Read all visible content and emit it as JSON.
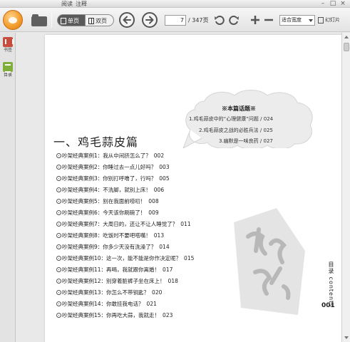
{
  "tabs": [
    "阅读",
    "注释"
  ],
  "window_controls": {
    "minimize": "–",
    "maximize": "□",
    "close": "×"
  },
  "toolbar": {
    "single_page": "单页",
    "double_page": "双页",
    "current_page": "7",
    "total_pages": "/ 347页",
    "zoom_mode": "适合宽度",
    "slideshow": "幻灯片",
    "icons": [
      "app-logo-icon",
      "open-folder-icon",
      "prev-page-icon",
      "next-page-icon",
      "rotate-left-icon",
      "rotate-right-icon",
      "zoom-in-icon",
      "zoom-out-icon",
      "slideshow-icon"
    ]
  },
  "sidebar": {
    "items": [
      {
        "label": "书签",
        "icon": "bookmark-icon"
      },
      {
        "label": "目录",
        "icon": "toc-icon"
      }
    ]
  },
  "page": {
    "bubble": {
      "title": "※本篇话题※",
      "items": [
        "1.鸡毛蒜皮中的“心理健康”问题 / 024",
        "2.鸡毛蒜皮之战的必胜兵法 / 025",
        "3.幽默是一味良药 / 027"
      ]
    },
    "chapter_title": "一、鸡毛蒜皮篇",
    "toc": [
      {
        "text": "吵架经典案例1：我从中间挤怎么了？",
        "page": "002"
      },
      {
        "text": "吵架经典案例2：你睡过去一点儿好吗？",
        "page": "003"
      },
      {
        "text": "吵架经典案例3：你别打呼噜了，行吗？",
        "page": "005"
      },
      {
        "text": "吵架经典案例4：不洗脚，就别上床！",
        "page": "006"
      },
      {
        "text": "吵架经典案例5：别在我面前唠叨！",
        "page": "008"
      },
      {
        "text": "吵架经典案例6：今天该你刷碗了！",
        "page": "009"
      },
      {
        "text": "吵架经典案例7：大周日的，还让不让人睡觉了？",
        "page": "011"
      },
      {
        "text": "吵架经典案例8：吃饭时不要吧嗒嘴！",
        "page": "013"
      },
      {
        "text": "吵架经典案例9：你多少天没有洗澡了？",
        "page": "014"
      },
      {
        "text": "吵架经典案例10：这一次，能不能是你作决定呢？",
        "page": "015"
      },
      {
        "text": "吵架经典案例11：再喝，我就跟你离婚！",
        "page": "017"
      },
      {
        "text": "吵架经典案例12：别穿着脏裤子坐在床上！",
        "page": "018"
      },
      {
        "text": "吵架经典案例13：你怎么不带钥匙？",
        "page": "020"
      },
      {
        "text": "吵架经典案例14：你敢挂我电话？",
        "page": "021"
      },
      {
        "text": "吵架经典案例15：你再吃大蒜，我就走！",
        "page": "023"
      }
    ],
    "side_label": "目录 contents",
    "page_number": "001"
  }
}
